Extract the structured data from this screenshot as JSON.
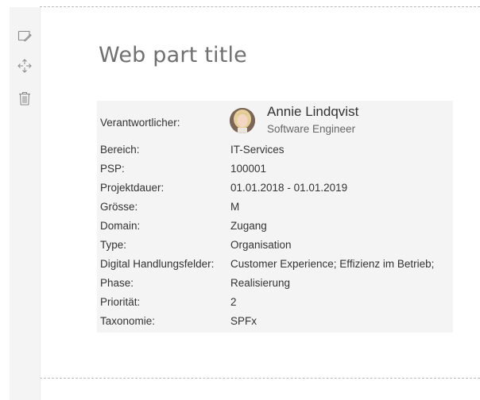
{
  "toolbar": {
    "icons": [
      "edit-icon",
      "move-icon",
      "delete-icon"
    ]
  },
  "webpart": {
    "title": "Web part title"
  },
  "person": {
    "label": "Verantwortlicher:",
    "name": "Annie Lindqvist",
    "role": "Software Engineer"
  },
  "details": [
    {
      "label": "Bereich:",
      "value": "IT-Services"
    },
    {
      "label": "PSP:",
      "value": "100001"
    },
    {
      "label": "Projektdauer:",
      "value": "01.01.2018 - 01.01.2019"
    },
    {
      "label": "Grösse:",
      "value": "M"
    },
    {
      "label": "Domain:",
      "value": "Zugang"
    },
    {
      "label": "Type:",
      "value": "Organisation"
    },
    {
      "label": "Digital Handlungsfelder:",
      "value": "Customer Experience; Effizienz im Betrieb;"
    },
    {
      "label": "Phase:",
      "value": "Realisierung"
    },
    {
      "label": "Priorität:",
      "value": "2"
    },
    {
      "label": "Taxonomie:",
      "value": "SPFx"
    }
  ],
  "colors": {
    "panel_bg": "#f4f4f4",
    "toolbar_bg": "#f4f4f4",
    "text": "#333333",
    "title": "#707070"
  }
}
